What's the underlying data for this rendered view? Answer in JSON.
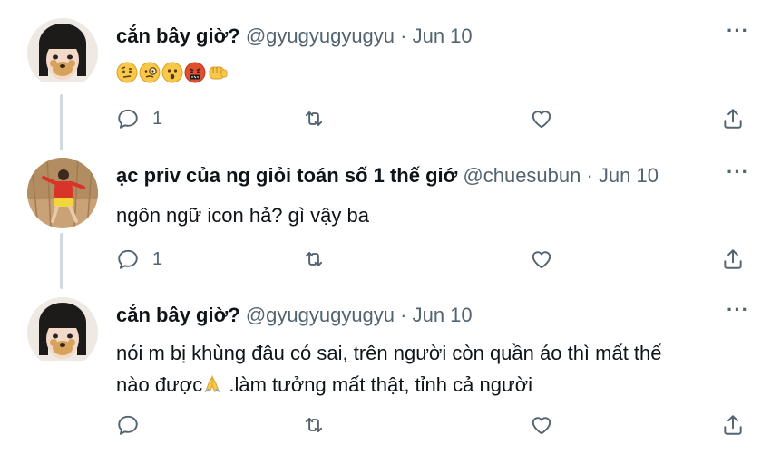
{
  "tweets": [
    {
      "name": "cắn bây giờ?",
      "meta": "@gyugyugyugyu · Jun 10",
      "emojis": [
        "face-with-raised-eyebrow",
        "face-with-monocle",
        "hushed-face",
        "face-with-symbols-on-mouth",
        "oncoming-fist"
      ],
      "reply_count": "1",
      "more": "···"
    },
    {
      "name": "ạc priv của ng giỏi toán số 1 thế giớ",
      "meta": "@chuesubun · Jun 10",
      "text": "ngôn ngữ icon hả? gì vậy ba",
      "reply_count": "1",
      "more": "···"
    },
    {
      "name": "cắn bây giờ?",
      "meta": "@gyugyugyugyu · Jun 10",
      "text_line1": "nói m bị khùng đâu có sai, trên người còn quần áo thì mất thế",
      "text_line2a": "nào được",
      "text_line2_emoji": "folded-hands",
      "text_line2b": " .làm tưởng mất thật, tỉnh cả người",
      "reply_count": "",
      "more": "···"
    }
  ],
  "colors": {
    "text": "#0f1419",
    "secondary": "#536471",
    "thread_line": "#cfd9de"
  },
  "icons": [
    "reply-icon",
    "retweet-icon",
    "like-icon",
    "share-icon",
    "more-icon"
  ]
}
